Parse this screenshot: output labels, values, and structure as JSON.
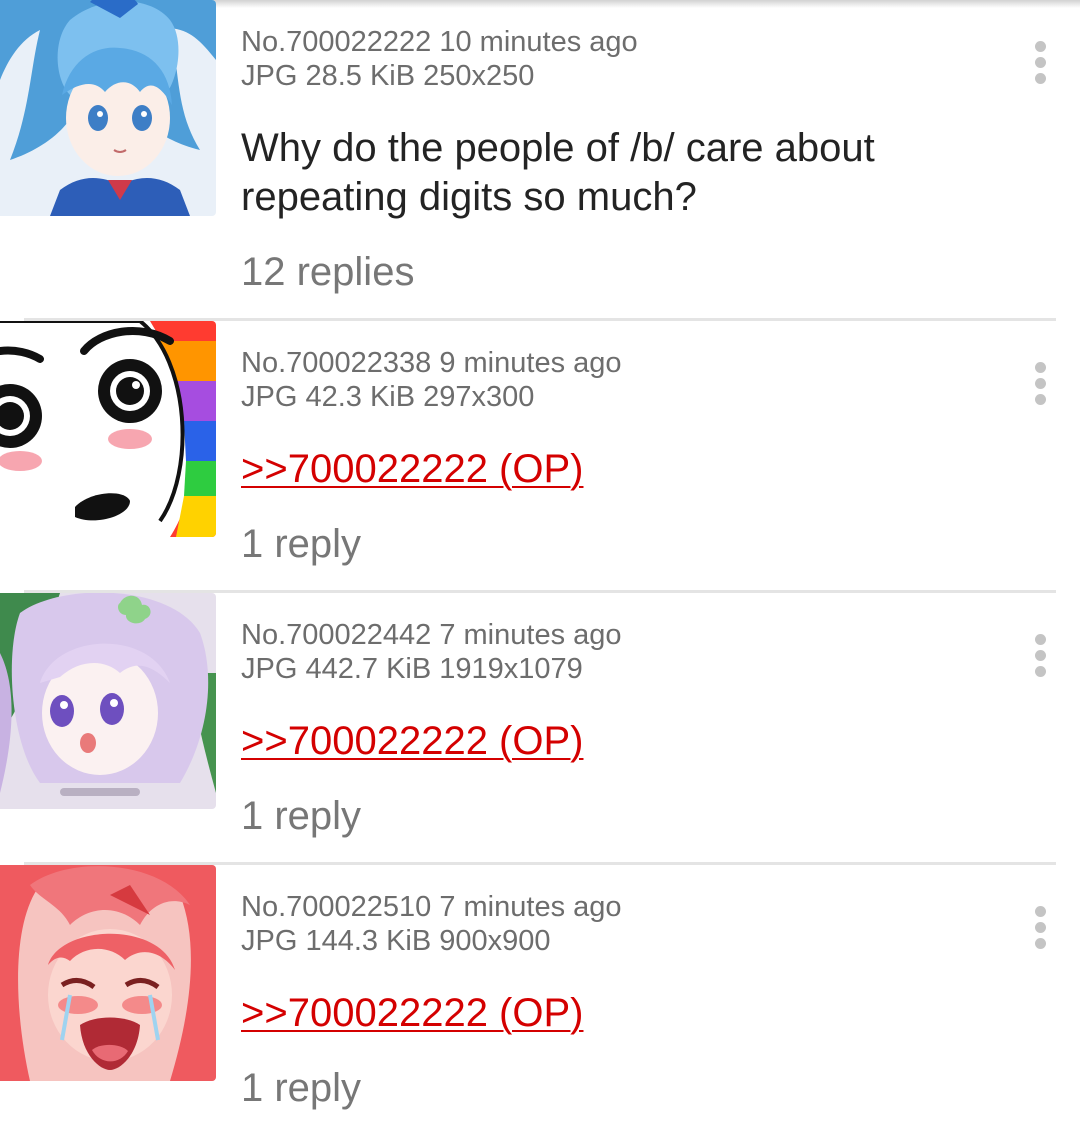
{
  "colors": {
    "link": "#d40000",
    "meta_text": "#6d6d6d",
    "body_text": "#232323",
    "reply_count": "#777777",
    "divider": "#e4e4e4"
  },
  "posts": [
    {
      "header": "No.700022222 10 minutes ago",
      "file_info": "JPG 28.5 KiB 250x250",
      "comment": "Why do the people of /b/ care about repeating digits so much?",
      "replies": "12 replies",
      "thumbnail": "anime-girl-blue-hair-thumbnail",
      "menu_icon": "overflow-menu-icon"
    },
    {
      "header": "No.700022338 9 minutes ago",
      "file_info": "JPG 42.3 KiB 297x300",
      "quote": ">>700022222 (OP)",
      "replies": "1 reply",
      "thumbnail": "amazed-face-rainbow-thumbnail",
      "menu_icon": "overflow-menu-icon"
    },
    {
      "header": "No.700022442 7 minutes ago",
      "file_info": "JPG 442.7 KiB 1919x1079",
      "quote": ">>700022222 (OP)",
      "replies": "1 reply",
      "thumbnail": "anime-girl-lavender-hair-thumbnail",
      "menu_icon": "overflow-menu-icon"
    },
    {
      "header": "No.700022510 7 minutes ago",
      "file_info": "JPG 144.3 KiB 900x900",
      "quote": ">>700022222 (OP)",
      "replies": "1 reply",
      "thumbnail": "anime-girl-crying-red-hair-thumbnail",
      "menu_icon": "overflow-menu-icon"
    }
  ]
}
